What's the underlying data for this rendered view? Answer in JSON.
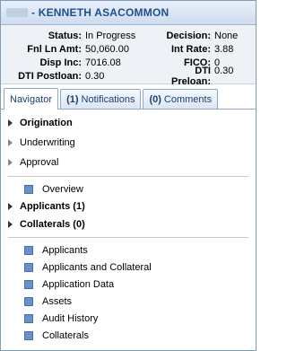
{
  "header": {
    "title": "- KENNETH ASACOMMON"
  },
  "summary": {
    "rows": [
      {
        "l_label": "Status:",
        "l_value": "In Progress",
        "r_label": "Decision:",
        "r_value": "None"
      },
      {
        "l_label": "Fnl Ln Amt:",
        "l_value": "50,060.00",
        "r_label": "Int Rate:",
        "r_value": "3.88"
      },
      {
        "l_label": "Disp Inc:",
        "l_value": "7016.08",
        "r_label": "FICO:",
        "r_value": "0"
      },
      {
        "l_label": "DTI Postloan:",
        "l_value": "0.30",
        "r_label": "DTI Preloan:",
        "r_value": "0.30"
      }
    ]
  },
  "tabs": {
    "navigator": "Navigator",
    "notifications_count": "(1)",
    "notifications": "Notifications",
    "comments_count": "(0)",
    "comments": "Comments"
  },
  "tree": {
    "origination": "Origination",
    "underwriting": "Underwriting",
    "approval": "Approval",
    "overview": "Overview",
    "applicants": "Applicants (1)",
    "collaterals": "Collaterals (0)"
  },
  "items": [
    "Applicants",
    "Applicants and Collateral",
    "Application Data",
    "Assets",
    "Audit History",
    "Collaterals"
  ],
  "colors": {
    "title_text": "#1f4f8c",
    "item_square": "#6b8fce",
    "tab_border": "#8fa7c8"
  }
}
